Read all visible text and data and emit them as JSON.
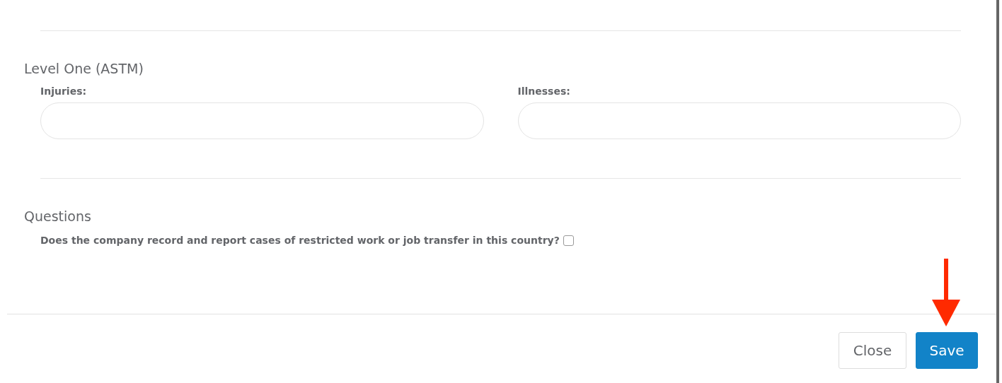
{
  "sections": [
    {
      "title": "Level One (ASTM)",
      "kind": "fields",
      "fields": [
        {
          "label": "Injuries:"
        },
        {
          "label": "Illnesses:"
        }
      ]
    },
    {
      "title": "Questions",
      "kind": "questions",
      "questions": [
        {
          "text": "Does the company record and report cases of restricted work or job transfer in this country?",
          "checked": false
        }
      ]
    }
  ],
  "footer": {
    "buttons": [
      {
        "label": "Close",
        "kind": "default"
      },
      {
        "label": "Save",
        "kind": "primary"
      }
    ]
  }
}
